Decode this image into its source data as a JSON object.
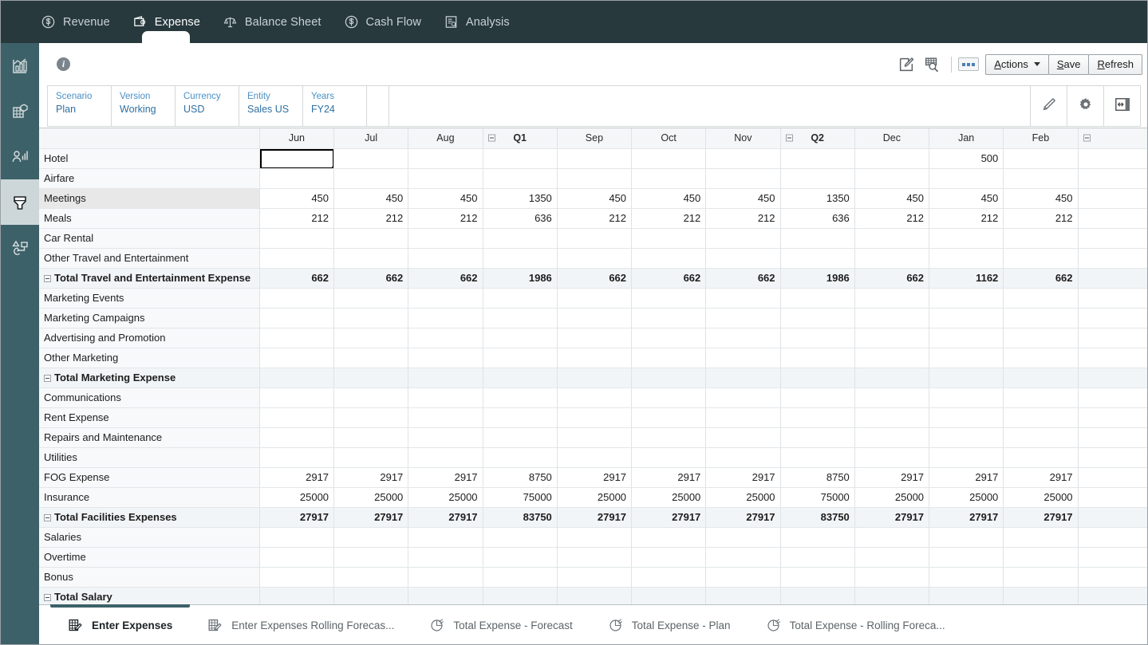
{
  "topnav": {
    "tabs": [
      {
        "label": "Revenue",
        "icon": "revenue-dollar-icon",
        "active": false
      },
      {
        "label": "Expense",
        "icon": "wallet-icon",
        "active": true
      },
      {
        "label": "Balance Sheet",
        "icon": "balance-scale-icon",
        "active": false
      },
      {
        "label": "Cash Flow",
        "icon": "cashflow-dollar-icon",
        "active": false
      },
      {
        "label": "Analysis",
        "icon": "analysis-report-icon",
        "active": false
      }
    ],
    "background_color": "#27393d"
  },
  "sidebar": {
    "background_color": "#3d6168",
    "items": [
      {
        "icon": "dashboard-chart-icon",
        "active": false
      },
      {
        "icon": "cube-grid-icon",
        "active": false
      },
      {
        "icon": "person-metrics-icon",
        "active": false
      },
      {
        "icon": "data-form-icon",
        "active": true
      },
      {
        "icon": "process-flow-icon",
        "active": false
      }
    ]
  },
  "toolbar": {
    "info_icon": "info-icon",
    "info_label": "i",
    "edit_icon": "edit-annotate-icon",
    "inspect_icon": "grid-search-icon",
    "dots_button_icon": "more-dots-icon",
    "actions_label": "Actions",
    "actions_accel": "A",
    "save_label": "Save",
    "save_accel": "S",
    "refresh_label": "Refresh",
    "refresh_accel": "R"
  },
  "pov": {
    "items": [
      {
        "dimension": "Scenario",
        "value": "Plan"
      },
      {
        "dimension": "Version",
        "value": "Working"
      },
      {
        "dimension": "Currency",
        "value": "USD"
      },
      {
        "dimension": "Entity",
        "value": "Sales US"
      },
      {
        "dimension": "Years",
        "value": "FY24"
      }
    ],
    "buttons": [
      {
        "icon": "pencil-icon"
      },
      {
        "icon": "gear-icon"
      },
      {
        "icon": "panel-resize-icon"
      }
    ]
  },
  "grid": {
    "columns": [
      {
        "label": "Jun",
        "type": "month",
        "collapsible": false
      },
      {
        "label": "Jul",
        "type": "month",
        "collapsible": false
      },
      {
        "label": "Aug",
        "type": "month",
        "collapsible": false
      },
      {
        "label": "Q1",
        "type": "quarter",
        "collapsible": true
      },
      {
        "label": "Sep",
        "type": "month",
        "collapsible": false
      },
      {
        "label": "Oct",
        "type": "month",
        "collapsible": false
      },
      {
        "label": "Nov",
        "type": "month",
        "collapsible": false
      },
      {
        "label": "Q2",
        "type": "quarter",
        "collapsible": true
      },
      {
        "label": "Dec",
        "type": "month",
        "collapsible": false
      },
      {
        "label": "Jan",
        "type": "month",
        "collapsible": false
      },
      {
        "label": "Feb",
        "type": "month",
        "collapsible": false
      },
      {
        "label": "",
        "type": "quarter",
        "collapsible": true
      }
    ],
    "selected_cell": {
      "row": 0,
      "column": 0
    },
    "hover_row": 2,
    "rows": [
      {
        "label": "Hotel",
        "indent": 1,
        "total": false,
        "collapsible": false,
        "values": [
          "",
          "",
          "",
          "",
          "",
          "",
          "",
          "",
          "",
          "500",
          "",
          ""
        ]
      },
      {
        "label": "Airfare",
        "indent": 1,
        "total": false,
        "collapsible": false,
        "values": [
          "",
          "",
          "",
          "",
          "",
          "",
          "",
          "",
          "",
          "",
          "",
          ""
        ]
      },
      {
        "label": "Meetings",
        "indent": 1,
        "total": false,
        "collapsible": false,
        "values": [
          "450",
          "450",
          "450",
          "1350",
          "450",
          "450",
          "450",
          "1350",
          "450",
          "450",
          "450",
          ""
        ]
      },
      {
        "label": "Meals",
        "indent": 1,
        "total": false,
        "collapsible": false,
        "values": [
          "212",
          "212",
          "212",
          "636",
          "212",
          "212",
          "212",
          "636",
          "212",
          "212",
          "212",
          ""
        ]
      },
      {
        "label": "Car Rental",
        "indent": 1,
        "total": false,
        "collapsible": false,
        "values": [
          "",
          "",
          "",
          "",
          "",
          "",
          "",
          "",
          "",
          "",
          "",
          ""
        ]
      },
      {
        "label": "Other Travel and Entertainment",
        "indent": 1,
        "total": false,
        "collapsible": false,
        "values": [
          "",
          "",
          "",
          "",
          "",
          "",
          "",
          "",
          "",
          "",
          "",
          ""
        ]
      },
      {
        "label": "Total Travel and Entertainment Expense",
        "indent": 0,
        "total": true,
        "collapsible": true,
        "values": [
          "662",
          "662",
          "662",
          "1986",
          "662",
          "662",
          "662",
          "1986",
          "662",
          "1162",
          "662",
          ""
        ]
      },
      {
        "label": "Marketing Events",
        "indent": 1,
        "total": false,
        "collapsible": false,
        "values": [
          "",
          "",
          "",
          "",
          "",
          "",
          "",
          "",
          "",
          "",
          "",
          ""
        ]
      },
      {
        "label": "Marketing Campaigns",
        "indent": 1,
        "total": false,
        "collapsible": false,
        "values": [
          "",
          "",
          "",
          "",
          "",
          "",
          "",
          "",
          "",
          "",
          "",
          ""
        ]
      },
      {
        "label": "Advertising and Promotion",
        "indent": 1,
        "total": false,
        "collapsible": false,
        "values": [
          "",
          "",
          "",
          "",
          "",
          "",
          "",
          "",
          "",
          "",
          "",
          ""
        ]
      },
      {
        "label": "Other Marketing",
        "indent": 1,
        "total": false,
        "collapsible": false,
        "values": [
          "",
          "",
          "",
          "",
          "",
          "",
          "",
          "",
          "",
          "",
          "",
          ""
        ]
      },
      {
        "label": "Total Marketing Expense",
        "indent": 0,
        "total": true,
        "collapsible": true,
        "values": [
          "",
          "",
          "",
          "",
          "",
          "",
          "",
          "",
          "",
          "",
          "",
          ""
        ]
      },
      {
        "label": "Communications",
        "indent": 1,
        "total": false,
        "collapsible": false,
        "values": [
          "",
          "",
          "",
          "",
          "",
          "",
          "",
          "",
          "",
          "",
          "",
          ""
        ]
      },
      {
        "label": "Rent Expense",
        "indent": 1,
        "total": false,
        "collapsible": false,
        "values": [
          "",
          "",
          "",
          "",
          "",
          "",
          "",
          "",
          "",
          "",
          "",
          ""
        ]
      },
      {
        "label": "Repairs and Maintenance",
        "indent": 1,
        "total": false,
        "collapsible": false,
        "values": [
          "",
          "",
          "",
          "",
          "",
          "",
          "",
          "",
          "",
          "",
          "",
          ""
        ]
      },
      {
        "label": "Utilities",
        "indent": 1,
        "total": false,
        "collapsible": false,
        "values": [
          "",
          "",
          "",
          "",
          "",
          "",
          "",
          "",
          "",
          "",
          "",
          ""
        ]
      },
      {
        "label": "FOG Expense",
        "indent": 1,
        "total": false,
        "collapsible": false,
        "values": [
          "2917",
          "2917",
          "2917",
          "8750",
          "2917",
          "2917",
          "2917",
          "8750",
          "2917",
          "2917",
          "2917",
          ""
        ]
      },
      {
        "label": "Insurance",
        "indent": 1,
        "total": false,
        "collapsible": false,
        "values": [
          "25000",
          "25000",
          "25000",
          "75000",
          "25000",
          "25000",
          "25000",
          "75000",
          "25000",
          "25000",
          "25000",
          ""
        ]
      },
      {
        "label": "Total Facilities Expenses",
        "indent": 0,
        "total": true,
        "collapsible": true,
        "values": [
          "27917",
          "27917",
          "27917",
          "83750",
          "27917",
          "27917",
          "27917",
          "83750",
          "27917",
          "27917",
          "27917",
          ""
        ]
      },
      {
        "label": "Salaries",
        "indent": 2,
        "total": false,
        "collapsible": false,
        "values": [
          "",
          "",
          "",
          "",
          "",
          "",
          "",
          "",
          "",
          "",
          "",
          ""
        ]
      },
      {
        "label": "Overtime",
        "indent": 2,
        "total": false,
        "collapsible": false,
        "values": [
          "",
          "",
          "",
          "",
          "",
          "",
          "",
          "",
          "",
          "",
          "",
          ""
        ]
      },
      {
        "label": "Bonus",
        "indent": 2,
        "total": false,
        "collapsible": false,
        "values": [
          "",
          "",
          "",
          "",
          "",
          "",
          "",
          "",
          "",
          "",
          "",
          ""
        ]
      },
      {
        "label": "Total Salary",
        "indent": 3,
        "total": true,
        "collapsible": true,
        "values": [
          "",
          "",
          "",
          "",
          "",
          "",
          "",
          "",
          "",
          "",
          "",
          ""
        ]
      }
    ]
  },
  "bottom_tabs": [
    {
      "label": "Enter Expenses",
      "icon": "data-form-icon",
      "active": true
    },
    {
      "label": "Enter Expenses Rolling Forecas...",
      "icon": "data-form-icon",
      "active": false
    },
    {
      "label": "Total Expense - Forecast",
      "icon": "pie-chart-icon",
      "active": false
    },
    {
      "label": "Total Expense - Plan",
      "icon": "pie-chart-icon",
      "active": false
    },
    {
      "label": "Total Expense - Rolling Foreca...",
      "icon": "pie-chart-icon",
      "active": false
    }
  ]
}
